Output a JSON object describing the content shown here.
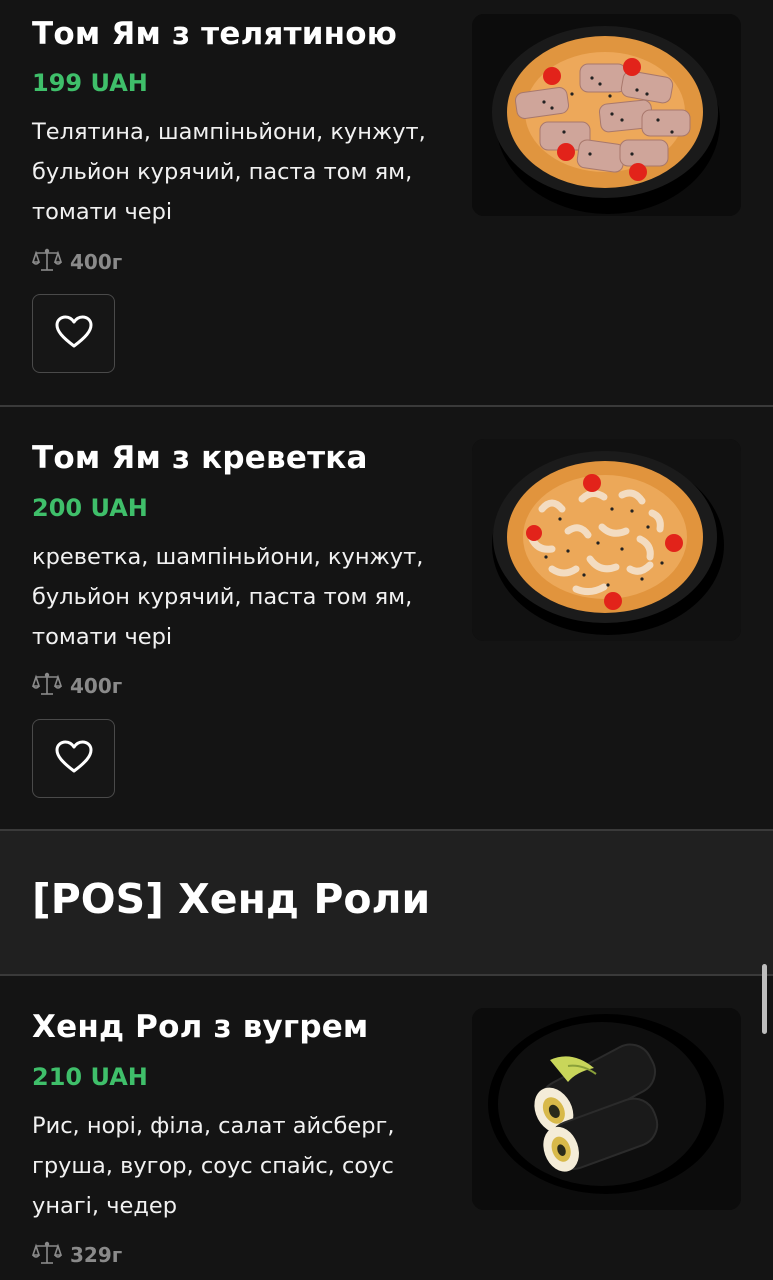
{
  "items": [
    {
      "title": "Том Ям з телятиною",
      "price": "199 UAH",
      "description": "Телятина, шампіньйони, кунжут, бульйон курячий, паста том ям, томати чері",
      "weight": "400г"
    },
    {
      "title": "Том Ям з креветка",
      "price": "200 UAH",
      "description": "креветка, шампіньйони, кунжут, бульйон курячий, паста том ям, томати чері",
      "weight": "400г"
    },
    {
      "title": "Хенд Рол з вугрем",
      "price": "210 UAH",
      "description": "Рис, норі, філа, салат айсберг, груша, вугор, соус спайс, соус унагі, чедер",
      "weight": "329г"
    }
  ],
  "section": {
    "title": "[POS] Хенд Роли"
  },
  "icons": {
    "weight": "scale-icon",
    "favorite": "heart-icon"
  },
  "colors": {
    "background": "#141414",
    "section_background": "#202020",
    "price": "#3fbf6a",
    "muted": "#8a8a8a"
  }
}
